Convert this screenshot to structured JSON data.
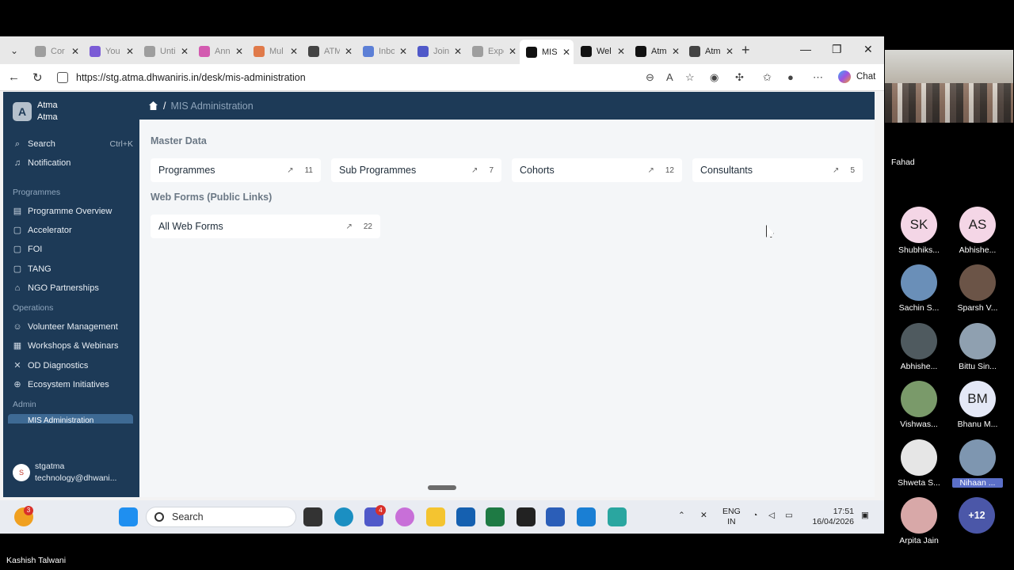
{
  "browser": {
    "tabs": [
      {
        "label": "Cor",
        "color": "#9e9e9e"
      },
      {
        "label": "You",
        "color": "#7b5cd6"
      },
      {
        "label": "Unti",
        "color": "#9e9e9e"
      },
      {
        "label": "Ann",
        "color": "#d35bb0"
      },
      {
        "label": "Mul",
        "color": "#e07a4a"
      },
      {
        "label": "ATM",
        "color": "#444444"
      },
      {
        "label": "Inbo",
        "color": "#5c7fd6"
      },
      {
        "label": "Join",
        "color": "#5059c9"
      },
      {
        "label": "Expe",
        "color": "#9e9e9e"
      },
      {
        "label": "MIS",
        "color": "#111111"
      },
      {
        "label": "Wel",
        "color": "#111111"
      },
      {
        "label": "Atm",
        "color": "#111111"
      },
      {
        "label": "Atm",
        "color": "#444444"
      }
    ],
    "url": "https://stg.atma.dhwaniris.in/desk/mis-administration",
    "chat_label": "Chat"
  },
  "sidebar": {
    "brand_initial": "A",
    "brand_title": "Atma",
    "brand_subtitle": "Atma",
    "search_label": "Search",
    "search_shortcut": "Ctrl+K",
    "notification_label": "Notification",
    "groups": {
      "programmes": "Programmes",
      "operations": "Operations",
      "admin": "Admin"
    },
    "programmes_items": [
      "Programme Overview",
      "Accelerator",
      "FOI",
      "TANG",
      "NGO Partnerships"
    ],
    "operations_items": [
      "Volunteer Management",
      "Workshops & Webinars",
      "OD Diagnostics",
      "Ecosystem Initiatives"
    ],
    "admin_active": "MIS Administration",
    "user_initial": "S",
    "user_name": "stgatma",
    "user_email": "technology@dhwani..."
  },
  "breadcrumb": {
    "separator": "/",
    "current": "MIS Administration"
  },
  "master_data": {
    "title": "Master Data",
    "cards": [
      {
        "label": "Programmes",
        "count": "11"
      },
      {
        "label": "Sub Programmes",
        "count": "7"
      },
      {
        "label": "Cohorts",
        "count": "12"
      },
      {
        "label": "Consultants",
        "count": "5"
      }
    ]
  },
  "web_forms": {
    "title": "Web Forms (Public Links)",
    "cards": [
      {
        "label": "All Web Forms",
        "count": "22"
      }
    ]
  },
  "taskbar": {
    "search_label": "Search",
    "app_badge_1": "3",
    "app_badge_2": "4",
    "lang_1": "ENG",
    "lang_2": "IN",
    "time": "17:51",
    "date": "16/04/2026"
  },
  "meeting": {
    "speaker": "Fahad",
    "participants": [
      {
        "initials": "SK",
        "name": "Shubhiks...",
        "color": "#f4d6e6"
      },
      {
        "initials": "AS",
        "name": "Abhishe...",
        "color": "#f4d6e6"
      },
      {
        "initials": "",
        "name": "Sachin S...",
        "color": "#6a8fb8"
      },
      {
        "initials": "",
        "name": "Sparsh V...",
        "color": "#6b5447"
      },
      {
        "initials": "",
        "name": "Abhishe...",
        "color": "#4f5a5f"
      },
      {
        "initials": "",
        "name": "Bittu Sin...",
        "color": "#8fa0b0"
      },
      {
        "initials": "",
        "name": "Vishwas...",
        "color": "#7a9a6a"
      },
      {
        "initials": "BM",
        "name": "Bhanu M...",
        "color": "#e4e8f6"
      },
      {
        "initials": "",
        "name": "Shweta S...",
        "color": "#e6e6e6"
      },
      {
        "initials": "",
        "name": "Nihaan ...",
        "color": "#7e96b0"
      },
      {
        "initials": "",
        "name": "Arpita Jain",
        "color": "#d8a8a8"
      }
    ],
    "more_count": "+12",
    "presenter": "Kashish Talwani"
  }
}
